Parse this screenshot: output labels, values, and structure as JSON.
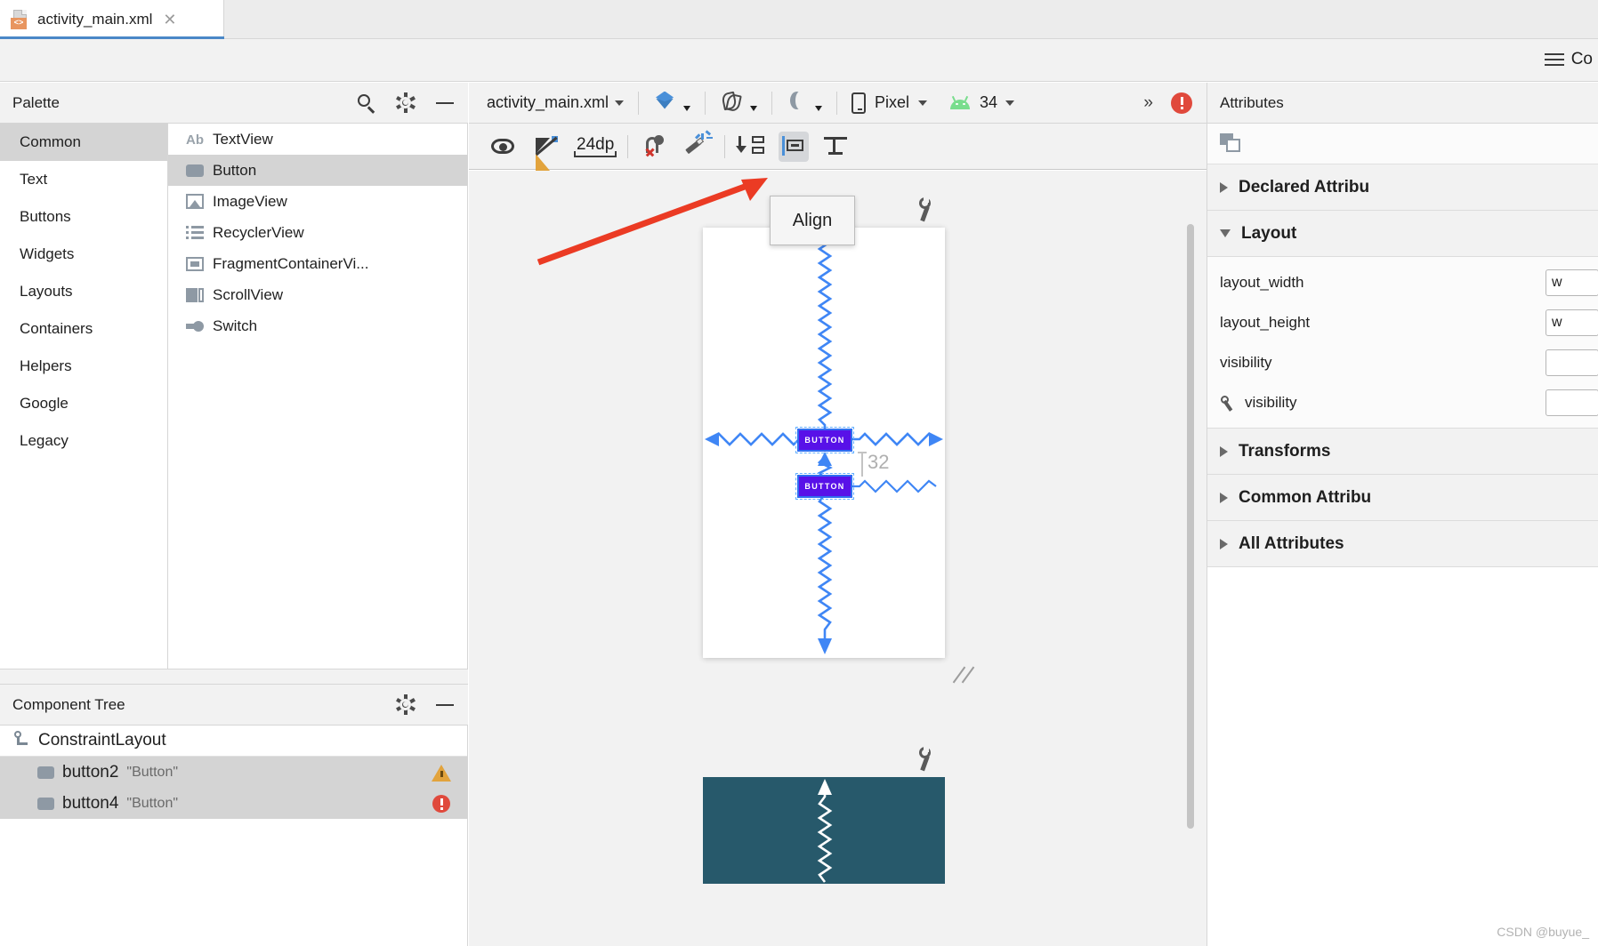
{
  "window": {
    "tab": {
      "label": "activity_main.xml",
      "close": "✕",
      "badge": "<>"
    },
    "toolbar_right": {
      "label": "Co",
      "menu_icon": "hamburger-icon"
    }
  },
  "palette": {
    "title": "Palette",
    "actions": [
      {
        "name": "search-icon",
        "label": ""
      },
      {
        "name": "gear-icon",
        "label": ""
      },
      {
        "name": "minimize-icon",
        "label": ""
      }
    ],
    "categories": [
      {
        "label": "Common",
        "selected": true
      },
      {
        "label": "Text",
        "selected": false
      },
      {
        "label": "Buttons",
        "selected": false
      },
      {
        "label": "Widgets",
        "selected": false
      },
      {
        "label": "Layouts",
        "selected": false
      },
      {
        "label": "Containers",
        "selected": false
      },
      {
        "label": "Helpers",
        "selected": false
      },
      {
        "label": "Google",
        "selected": false
      },
      {
        "label": "Legacy",
        "selected": false
      }
    ],
    "items": [
      {
        "label": "TextView",
        "icon": "text-view-icon",
        "selected": false
      },
      {
        "label": "Button",
        "icon": "button-icon",
        "selected": true
      },
      {
        "label": "ImageView",
        "icon": "image-view-icon",
        "selected": false
      },
      {
        "label": "RecyclerView",
        "icon": "recycler-view-icon",
        "selected": false
      },
      {
        "label": "FragmentContainerVi...",
        "icon": "fragment-container-icon",
        "selected": false
      },
      {
        "label": "ScrollView",
        "icon": "scroll-view-icon",
        "selected": false
      },
      {
        "label": "Switch",
        "icon": "switch-icon",
        "selected": false
      }
    ]
  },
  "component_tree": {
    "title": "Component Tree",
    "actions": [
      {
        "name": "gear-icon"
      },
      {
        "name": "minimize-icon"
      }
    ],
    "rows": [
      {
        "name": "ConstraintLayout",
        "value": "",
        "status": "none",
        "indent": 0,
        "selected": false,
        "icon": "constraint-layout-icon"
      },
      {
        "name": "button2",
        "value": "\"Button\"",
        "status": "warning",
        "indent": 1,
        "selected": true,
        "icon": "button-icon"
      },
      {
        "name": "button4",
        "value": "\"Button\"",
        "status": "error",
        "indent": 1,
        "selected": true,
        "icon": "button-icon"
      }
    ]
  },
  "design_toolbar": {
    "file_name": "activity_main.xml",
    "view_mode_icon": "layers-icon",
    "blueprint_icon": "blueprint-toggle-icon",
    "orientation_icon": "orientation-icon",
    "device_icon": "phone-icon",
    "device_name": "Pixel",
    "api_icon": "android-icon",
    "api_level": "34",
    "overflow": "»",
    "error_icon": "error-badge-icon"
  },
  "design_toolbar2": {
    "items": [
      {
        "name": "show-constraints-icon",
        "label": "",
        "active": false
      },
      {
        "name": "hide-constraints-icon",
        "label": "",
        "active": false
      },
      {
        "name": "default-margin-label",
        "label": "24dp",
        "active": false
      },
      {
        "name": "clear-constraints-icon",
        "label": "",
        "active": false
      },
      {
        "name": "infer-constraints-icon",
        "label": "",
        "active": false
      },
      {
        "name": "pack-icon",
        "label": "",
        "active": false
      },
      {
        "name": "align-icon",
        "label": "",
        "active": true
      },
      {
        "name": "guidelines-icon",
        "label": "",
        "active": false
      }
    ]
  },
  "canvas": {
    "tooltip": "Align",
    "widgets": [
      {
        "name": "button2-chip",
        "label": "BUTTON"
      },
      {
        "name": "button4-chip",
        "label": "BUTTON"
      }
    ],
    "margin_label": "32",
    "wrench_badges": [
      "design-surface-wrench-1",
      "design-surface-wrench-2"
    ]
  },
  "attributes": {
    "title": "Attributes",
    "copy_icon": "copy-icon",
    "sections": [
      {
        "label": "Declared Attribu",
        "expanded": false
      },
      {
        "label": "Layout",
        "expanded": true
      },
      {
        "label": "Transforms",
        "expanded": false
      },
      {
        "label": "Common Attribu",
        "expanded": false
      },
      {
        "label": "All Attributes",
        "expanded": false
      }
    ],
    "layout_rows": [
      {
        "label": "layout_width",
        "value": "w",
        "wrench": false
      },
      {
        "label": "layout_height",
        "value": "w",
        "wrench": false
      },
      {
        "label": "visibility",
        "value": "",
        "wrench": false
      },
      {
        "label": "visibility",
        "value": "",
        "wrench": true
      }
    ]
  },
  "watermark": "CSDN @buyue_"
}
